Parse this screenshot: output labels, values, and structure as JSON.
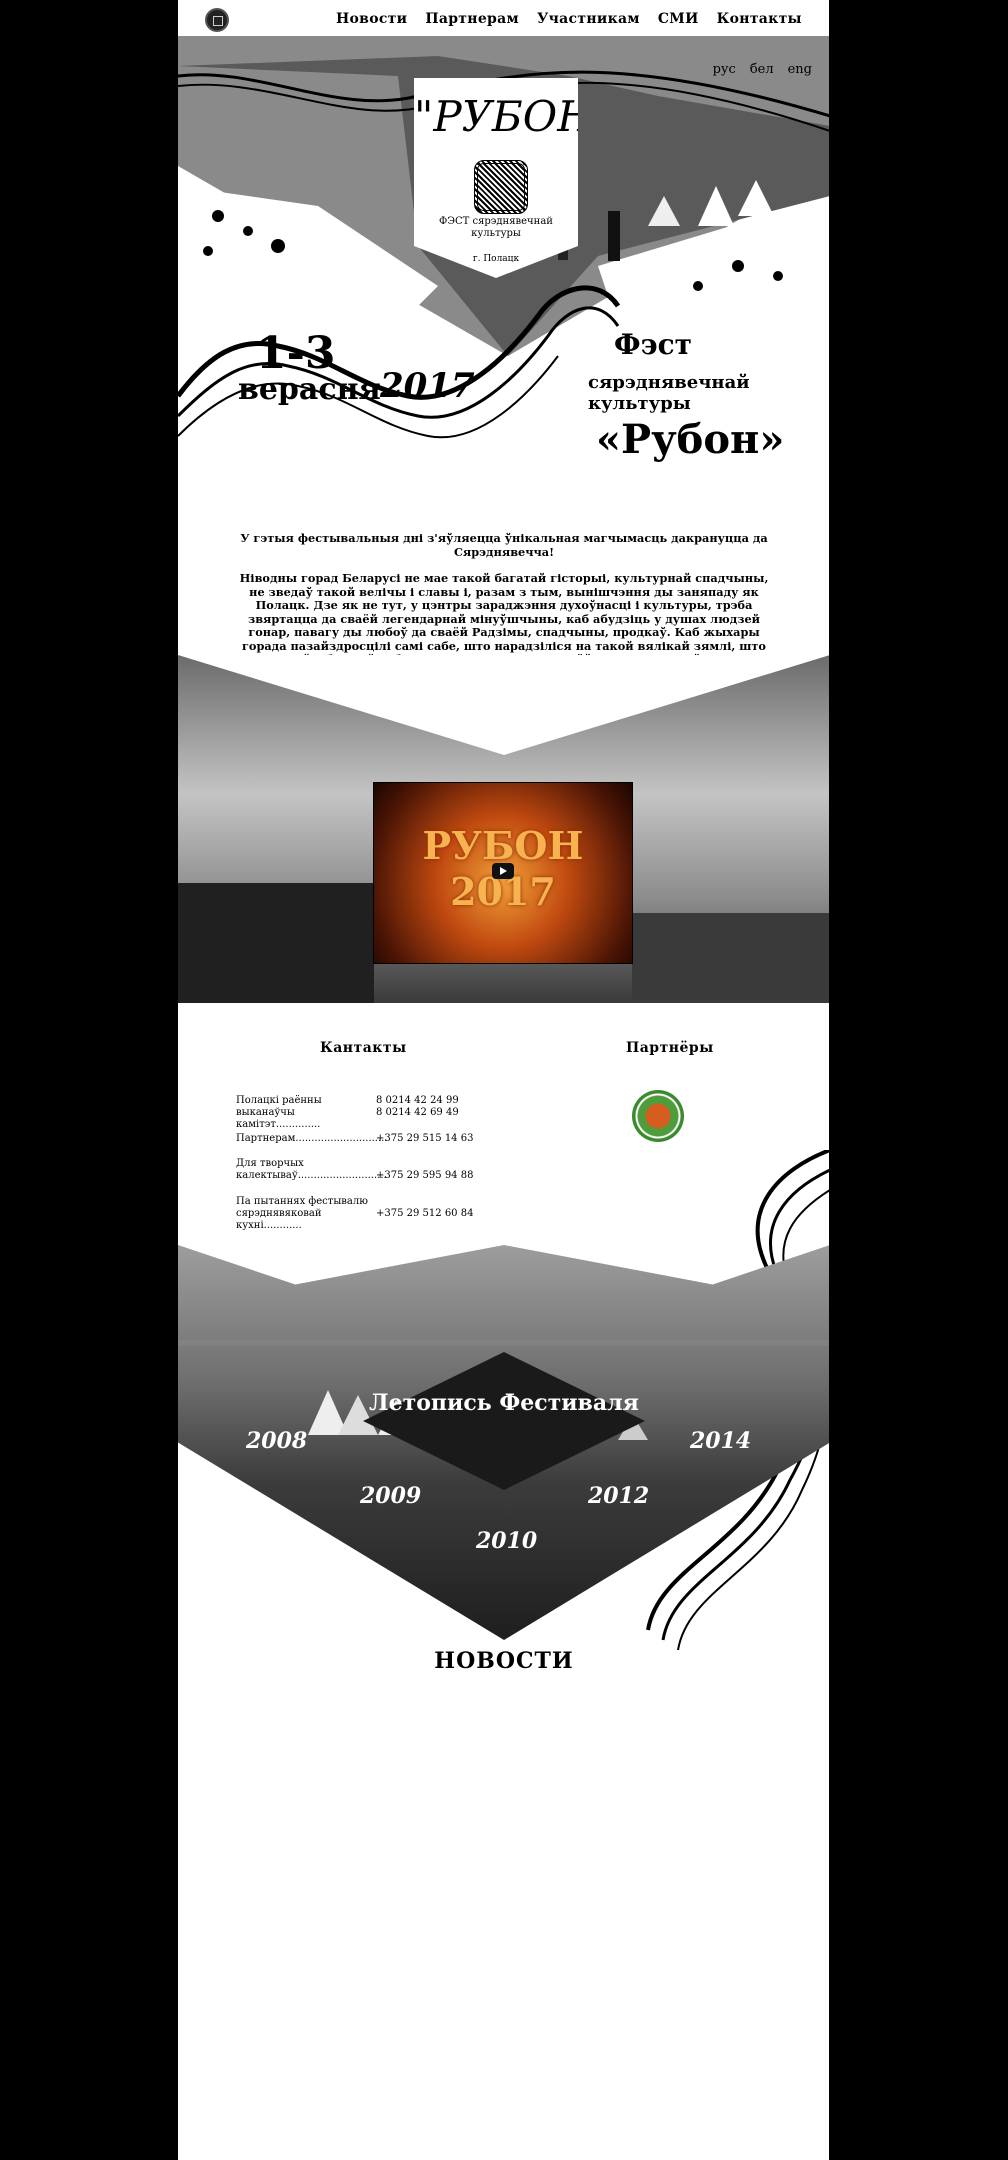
{
  "nav": {
    "links": [
      "Новости",
      "Партнерам",
      "Участникам",
      "СМИ",
      "Контакты"
    ]
  },
  "lang": [
    "рус",
    "бел",
    "eng"
  ],
  "banner": {
    "title": "\"РУБОН\"",
    "subtitle": "ФЭСТ сярэднявечнай культуры",
    "city": "г. Полацк"
  },
  "hero": {
    "dates": "1-3",
    "month": "верасня",
    "year": "2017",
    "fest": "Фэст",
    "culture": "сярэднявечнай культуры",
    "name": "«Рубон»"
  },
  "intro": {
    "line1": "У гэтыя фестывальныя дні з'яўляецца ўнікальная магчымасць дакрануцца да Сярэднявечча!",
    "line2": "Ніводны горад Беларусі не мае такой багатай гісторыі, культурнай спадчыны, не зведаў такой велічы і славы і, разам з тым, вынішчэння ды заняпаду як Полацк. Дзе як не тут, у цэнтры зараджэння духоўнасці і культуры, трэба звяртацца да сваёй легендарнай мінуўшчыны, каб абудзіць у душах людзей гонар, павагу ды любоў да сваёй Радзімы, спадчыны, продкаў. Каб жыхары горада пазайздросцілі самі сабе, што нарадзіліся на такой вялікай зямлі, што ўвабрала ў сябе энергетыку адданых сваёй радзіме людзей."
  },
  "video": {
    "line1": "РУБОН",
    "line2": "2017"
  },
  "contacts": {
    "heading": "Кантакты",
    "rows": [
      {
        "label": "Полацкі раённы выканаўчы камітэт..............",
        "value": "8 0214 42 24 99\n8 0214 42 69 49"
      },
      {
        "label": "Партнерам.............................",
        "value": "+375 29 515 14 63"
      },
      {
        "label": "Для творчых калектываў............................",
        "value": "+375 29 595 94 88"
      },
      {
        "label": "Па пытаннях фестывалю сярэднявяковай кухні............",
        "value": "+375 29 512 60 84"
      }
    ]
  },
  "partners": {
    "heading": "Партнёры"
  },
  "chronicle": {
    "title": "Летопись Фестиваля",
    "years": [
      "2008",
      "2009",
      "2010",
      "2012",
      "2014"
    ]
  },
  "news": {
    "heading": "НОВОСТИ"
  }
}
